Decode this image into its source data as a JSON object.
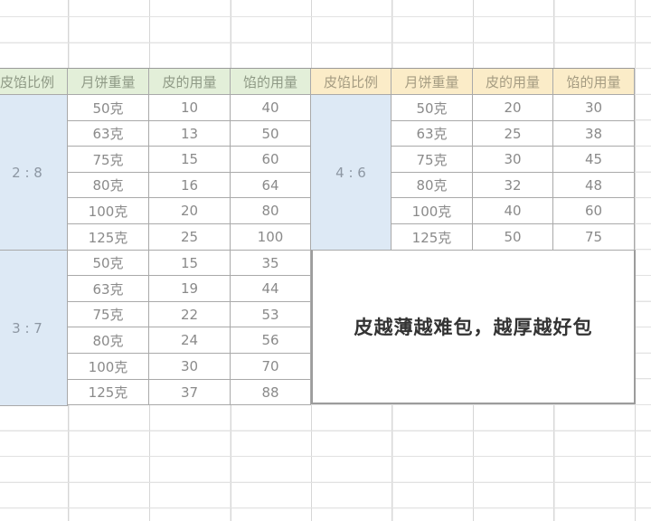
{
  "sheet": {
    "left_table": {
      "headers": [
        "皮馅比例",
        "月饼重量",
        "皮的用量",
        "馅的用量"
      ],
      "header_color": "#e3efd9",
      "groups": [
        {
          "ratio": "2 : 8",
          "rows": [
            [
              "50克",
              "10",
              "40"
            ],
            [
              "63克",
              "13",
              "50"
            ],
            [
              "75克",
              "15",
              "60"
            ],
            [
              "80克",
              "16",
              "64"
            ],
            [
              "100克",
              "20",
              "80"
            ],
            [
              "125克",
              "25",
              "100"
            ]
          ]
        },
        {
          "ratio": "3 : 7",
          "rows": [
            [
              "50克",
              "15",
              "35"
            ],
            [
              "63克",
              "19",
              "44"
            ],
            [
              "75克",
              "22",
              "53"
            ],
            [
              "80克",
              "24",
              "56"
            ],
            [
              "100克",
              "30",
              "70"
            ],
            [
              "125克",
              "37",
              "88"
            ]
          ]
        }
      ]
    },
    "right_table": {
      "headers": [
        "皮馅比例",
        "月饼重量",
        "皮的用量",
        "馅的用量"
      ],
      "header_color": "#fbecc8",
      "groups": [
        {
          "ratio": "4 : 6",
          "rows": [
            [
              "50克",
              "20",
              "30"
            ],
            [
              "63克",
              "25",
              "38"
            ],
            [
              "75克",
              "30",
              "45"
            ],
            [
              "80克",
              "32",
              "48"
            ],
            [
              "100克",
              "40",
              "60"
            ],
            [
              "125克",
              "50",
              "75"
            ]
          ]
        }
      ]
    },
    "note": "皮越薄越难包，越厚越好包",
    "ratio_fill_color": "#dde9f5"
  }
}
